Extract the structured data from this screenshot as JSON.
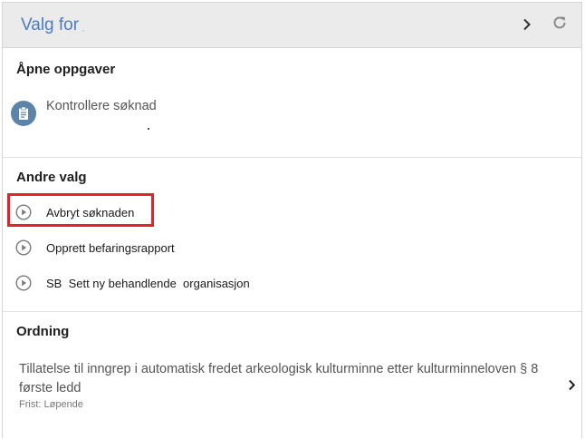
{
  "header": {
    "title": "Valg for",
    "chevron_icon": "chevron-right-icon",
    "refresh_icon": "refresh-icon"
  },
  "open_tasks": {
    "title": "Åpne oppgaver",
    "items": [
      {
        "label": "Kontrollere søknad",
        "icon": "clipboard-icon"
      }
    ]
  },
  "other_options": {
    "title": "Andre valg",
    "items": [
      {
        "label": "Avbryt søknaden",
        "icon": "play-circle-icon",
        "highlighted": true,
        "highlight_color": "#e8202a"
      },
      {
        "label": "Opprett befaringsrapport",
        "icon": "play-circle-icon"
      },
      {
        "label": "SB  Sett ny behandlende  organisasjon",
        "icon": "play-circle-icon"
      }
    ]
  },
  "ordning": {
    "title": "Ordning",
    "description": "Tillatelse til inngrep i automatisk fredet arkeologisk kulturminne etter kulturminneloven § 8 første ledd",
    "deadline": "Frist: Løpende"
  },
  "colors": {
    "header_bg": "#ebebeb",
    "title_blue": "#4a7dbf",
    "task_icon_bg": "#5b84a8",
    "highlight_red": "#e8202a"
  }
}
